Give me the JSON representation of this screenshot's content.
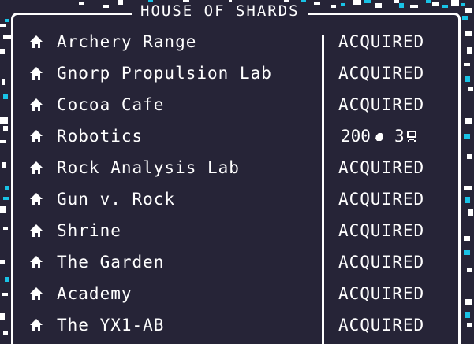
{
  "panel": {
    "title": "HOUSE OF SHARDS"
  },
  "buildings": [
    {
      "name": "Archery Range",
      "status": "ACQUIRED",
      "icon": "house-icon"
    },
    {
      "name": "Gnorp Propulsion Lab",
      "status": "ACQUIRED",
      "icon": "house-icon"
    },
    {
      "name": "Cocoa Cafe",
      "status": "ACQUIRED",
      "icon": "house-icon"
    },
    {
      "name": "Robotics",
      "status": "",
      "icon": "house-icon",
      "cost": {
        "amount": "200",
        "shard_icon": "shard-icon",
        "secondary": "3",
        "secondary_icon": "token-icon"
      }
    },
    {
      "name": "Rock Analysis Lab",
      "status": "ACQUIRED",
      "icon": "house-icon"
    },
    {
      "name": "Gun v. Rock",
      "status": "ACQUIRED",
      "icon": "house-icon"
    },
    {
      "name": "Shrine",
      "status": "ACQUIRED",
      "icon": "house-icon"
    },
    {
      "name": "The Garden",
      "status": "ACQUIRED",
      "icon": "house-icon"
    },
    {
      "name": "Academy",
      "status": "ACQUIRED",
      "icon": "house-icon"
    },
    {
      "name": "The YX1-AB",
      "status": "ACQUIRED",
      "icon": "house-icon"
    }
  ],
  "colors": {
    "background": "#262437",
    "text": "#ffffff",
    "accent": "#19c3e6"
  }
}
